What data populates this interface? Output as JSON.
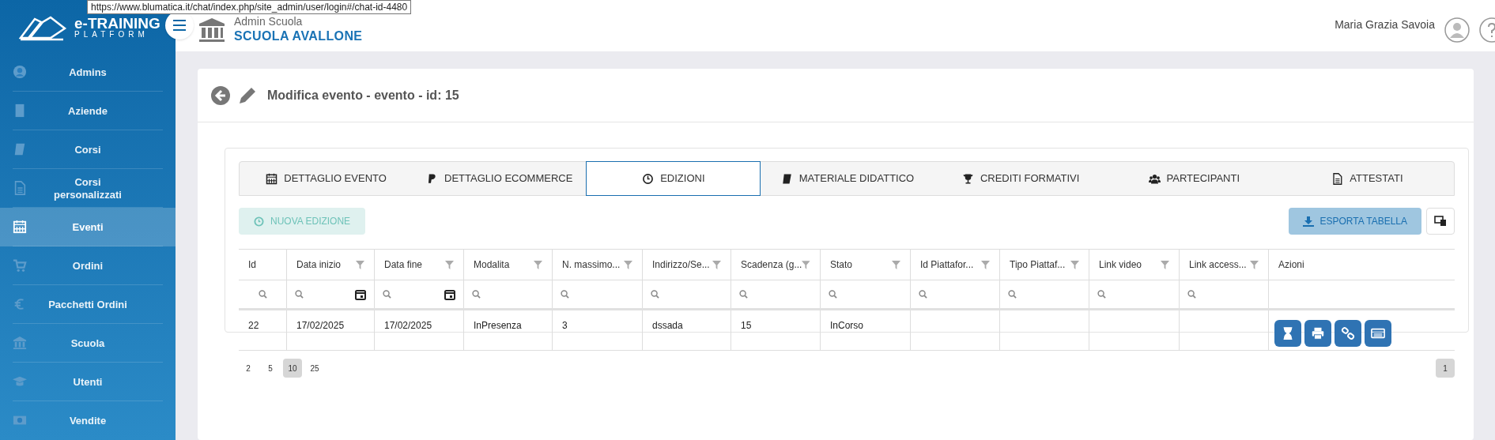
{
  "tooltip": "https://www.blumatica.it/chat/index.php/site_admin/user/login#/chat-id-4480",
  "logo": {
    "title": "e-TRAINING",
    "subtitle": "PLATFORM"
  },
  "header": {
    "role": "Admin Scuola",
    "school": "SCUOLA AVALLONE",
    "user": "Maria Grazia Savoia"
  },
  "sidebar": {
    "items": [
      {
        "label": "Admins",
        "selected": false
      },
      {
        "label": "Aziende",
        "selected": false
      },
      {
        "label": "Corsi",
        "selected": false
      },
      {
        "label": "Corsi personalizzati",
        "selected": false
      },
      {
        "label": "Eventi",
        "selected": true
      },
      {
        "label": "Ordini",
        "selected": false
      },
      {
        "label": "Pacchetti Ordini",
        "selected": false
      },
      {
        "label": "Scuola",
        "selected": false
      },
      {
        "label": "Utenti",
        "selected": false
      },
      {
        "label": "Vendite",
        "selected": false
      }
    ]
  },
  "page_title": "Modifica evento - evento - id: 15",
  "tabs": [
    {
      "label": "DETTAGLIO EVENTO",
      "selected": false
    },
    {
      "label": "DETTAGLIO ECOMMERCE",
      "selected": false
    },
    {
      "label": "EDIZIONI",
      "selected": true
    },
    {
      "label": "MATERIALE DIDATTICO",
      "selected": false
    },
    {
      "label": "CREDITI FORMATIVI",
      "selected": false
    },
    {
      "label": "PARTECIPANTI",
      "selected": false
    },
    {
      "label": "ATTESTATI",
      "selected": false
    }
  ],
  "new_button": {
    "label": "NUOVA EDIZIONE",
    "disabled": true
  },
  "export_button": {
    "label": "ESPORTA TABELLA"
  },
  "table": {
    "columns": [
      {
        "label": "Id",
        "kind": "id"
      },
      {
        "label": "Data inizio",
        "kind": "date"
      },
      {
        "label": "Data fine",
        "kind": "date"
      },
      {
        "label": "Modalita",
        "kind": "text"
      },
      {
        "label": "N. massimo...",
        "kind": "text"
      },
      {
        "label": "Indirizzo/Se...",
        "kind": "text"
      },
      {
        "label": "Scadenza (g...",
        "kind": "text"
      },
      {
        "label": "Stato",
        "kind": "text"
      },
      {
        "label": "Id Piattafor...",
        "kind": "text"
      },
      {
        "label": "Tipo Piattaf...",
        "kind": "text"
      },
      {
        "label": "Link video",
        "kind": "text"
      },
      {
        "label": "Link access...",
        "kind": "text"
      },
      {
        "label": "Azioni",
        "kind": "actions"
      }
    ],
    "rows": [
      {
        "cells": [
          "22",
          "17/02/2025",
          "17/02/2025",
          "InPresenza",
          "3",
          "dssada",
          "15",
          "InCorso",
          "",
          "",
          "",
          ""
        ]
      }
    ]
  },
  "page_sizes": [
    {
      "label": "2",
      "selected": false
    },
    {
      "label": "5",
      "selected": false
    },
    {
      "label": "10",
      "selected": true
    },
    {
      "label": "25",
      "selected": false
    }
  ],
  "pages": [
    {
      "label": "1",
      "selected": true
    }
  ]
}
